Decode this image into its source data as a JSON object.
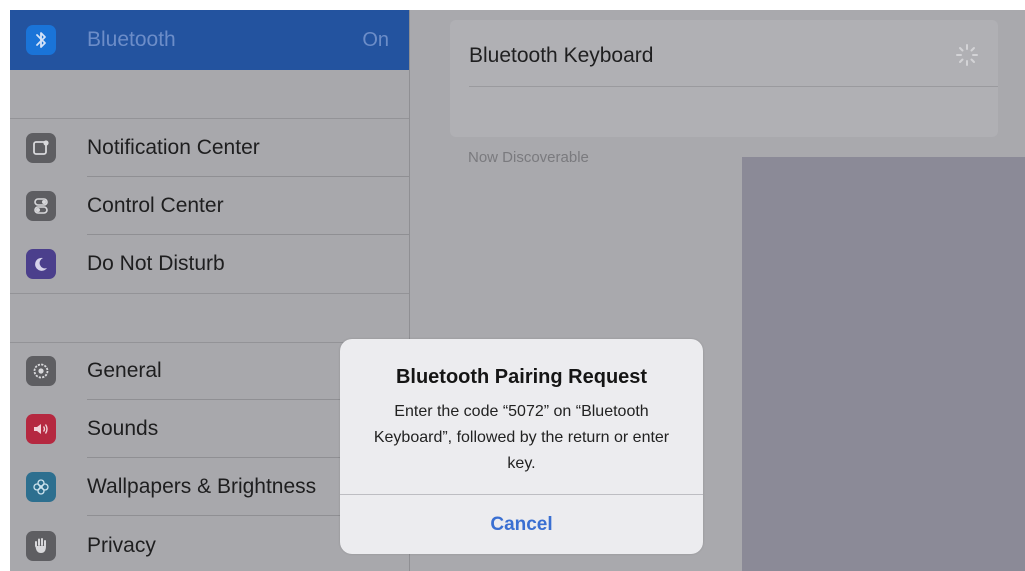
{
  "sidebar": {
    "bluetooth": {
      "label": "Bluetooth",
      "value": "On",
      "icon": "bluetooth-icon"
    },
    "items": [
      {
        "label": "Notification Center",
        "icon": "notification-center-icon"
      },
      {
        "label": "Control Center",
        "icon": "control-center-icon"
      },
      {
        "label": "Do Not Disturb",
        "icon": "moon-icon"
      },
      {
        "label": "General",
        "icon": "gear-icon"
      },
      {
        "label": "Sounds",
        "icon": "speaker-icon"
      },
      {
        "label": "Wallpapers & Brightness",
        "icon": "flower-icon"
      },
      {
        "label": "Privacy",
        "icon": "hand-icon"
      }
    ]
  },
  "detail": {
    "device_name": "Bluetooth Keyboard",
    "discoverable_text": "Now Discoverable"
  },
  "alert": {
    "title": "Bluetooth Pairing Request",
    "message": "Enter the code “5072” on “Bluetooth Keyboard”, followed by the return or enter key.",
    "cancel_label": "Cancel"
  },
  "colors": {
    "accent": "#3a6fd2",
    "selected_row": "#23539f"
  }
}
